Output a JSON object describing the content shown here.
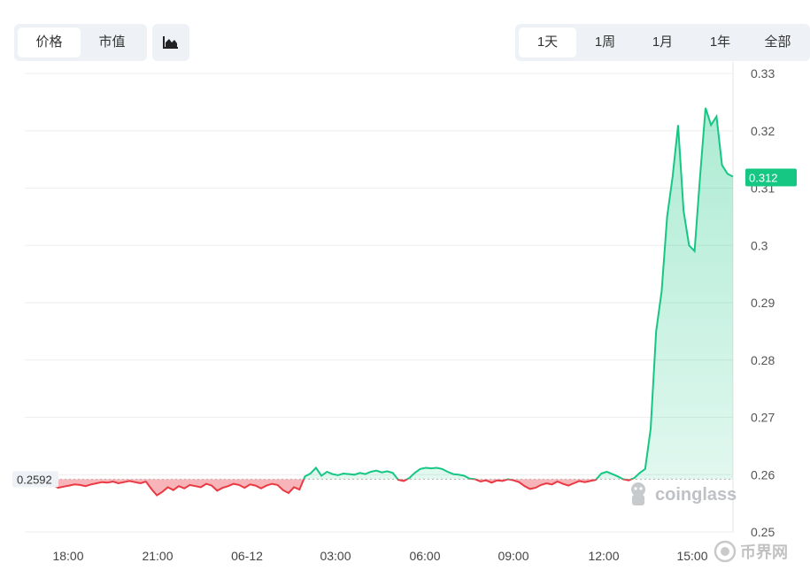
{
  "controls": {
    "metric_tabs": [
      {
        "label": "价格",
        "active": true
      },
      {
        "label": "市值",
        "active": false
      }
    ],
    "chart_type_icon": "area-chart-icon",
    "range_tabs": [
      {
        "label": "1天",
        "active": true
      },
      {
        "label": "1周",
        "active": false
      },
      {
        "label": "1月",
        "active": false
      },
      {
        "label": "1年",
        "active": false
      },
      {
        "label": "全部",
        "active": false
      }
    ]
  },
  "watermarks": {
    "coinglass": "coinglass",
    "site": "币界网"
  },
  "colors": {
    "up": "#16c784",
    "down": "#ea3943",
    "up_fill": "#d6f3e6",
    "down_fill": "#f6a8ad",
    "grid": "#eeeeee"
  },
  "chart_data": {
    "type": "area",
    "title": "",
    "xlabel": "",
    "ylabel": "",
    "x_ticks": [
      "18:00",
      "21:00",
      "06-12",
      "03:00",
      "06:00",
      "09:00",
      "12:00",
      "15:00"
    ],
    "y_ticks": [
      "0.25",
      "0.26",
      "0.27",
      "0.28",
      "0.29",
      "0.3",
      "0.31",
      "0.32",
      "0.33"
    ],
    "ylim": [
      0.25,
      0.33
    ],
    "y_axis_position": "right",
    "grid": true,
    "baseline": 0.2592,
    "baseline_label": "0.2592",
    "last_value_label": "0.312",
    "series": [
      {
        "values": [
          0.2592,
          0.2585,
          0.2582,
          0.2577,
          0.2579,
          0.2581,
          0.2583,
          0.2582,
          0.258,
          0.2583,
          0.2585,
          0.2587,
          0.2586,
          0.2588,
          0.2585,
          0.2587,
          0.2589,
          0.2587,
          0.2585,
          0.2588,
          0.2575,
          0.2564,
          0.257,
          0.2578,
          0.2573,
          0.258,
          0.2576,
          0.2582,
          0.258,
          0.2578,
          0.2584,
          0.2581,
          0.2572,
          0.2577,
          0.258,
          0.2584,
          0.2582,
          0.2577,
          0.2583,
          0.2581,
          0.2576,
          0.2581,
          0.2584,
          0.2582,
          0.2573,
          0.2568,
          0.2578,
          0.2574,
          0.2597,
          0.2602,
          0.2612,
          0.2598,
          0.2605,
          0.2601,
          0.2599,
          0.2602,
          0.2601,
          0.26,
          0.2603,
          0.2601,
          0.2605,
          0.2607,
          0.2604,
          0.2606,
          0.2603,
          0.2591,
          0.2589,
          0.2594,
          0.2603,
          0.261,
          0.2612,
          0.2611,
          0.2612,
          0.261,
          0.2605,
          0.2601,
          0.26,
          0.2598,
          0.2593,
          0.2592,
          0.2588,
          0.259,
          0.2586,
          0.259,
          0.2589,
          0.2592,
          0.259,
          0.2587,
          0.258,
          0.2575,
          0.2577,
          0.2582,
          0.2585,
          0.2583,
          0.2588,
          0.2584,
          0.2581,
          0.2585,
          0.2589,
          0.2587,
          0.2589,
          0.2591,
          0.2602,
          0.2605,
          0.2601,
          0.2597,
          0.2592,
          0.259,
          0.2594,
          0.2603,
          0.261,
          0.268,
          0.285,
          0.292,
          0.305,
          0.312,
          0.321,
          0.306,
          0.3,
          0.299,
          0.312,
          0.324,
          0.321,
          0.3225,
          0.314,
          0.3125,
          0.312
        ]
      }
    ]
  }
}
